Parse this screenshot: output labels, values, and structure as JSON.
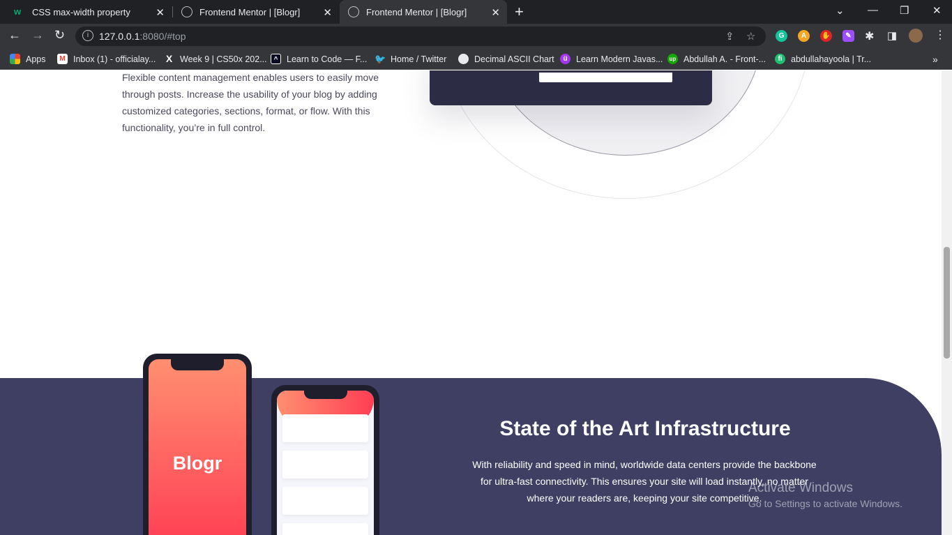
{
  "tabs": [
    {
      "title": "CSS max-width property",
      "favicon": "w3schools-icon",
      "color": "#04aa6d"
    },
    {
      "title": "Frontend Mentor | [Blogr]",
      "favicon": "globe-icon",
      "color": "#bdc1c6"
    },
    {
      "title": "Frontend Mentor | [Blogr]",
      "favicon": "globe-icon",
      "color": "#bdc1c6"
    }
  ],
  "address_bar": {
    "host": "127.0.0.1",
    "rest": ":8080/#top"
  },
  "bookmarks": [
    {
      "label": "Apps",
      "icon": "apps-grid-icon"
    },
    {
      "label": "Inbox (1) - officialay...",
      "icon": "gmail-icon"
    },
    {
      "label": "Week 9 | CS50x 202...",
      "icon": "x-icon"
    },
    {
      "label": "Learn to Code — F...",
      "icon": "freecodecamp-icon"
    },
    {
      "label": "Home / Twitter",
      "icon": "twitter-icon"
    },
    {
      "label": "Decimal ASCII Chart",
      "icon": "globe-icon"
    },
    {
      "label": "Learn Modern Javas...",
      "icon": "udemy-icon"
    },
    {
      "label": "Abdullah A. - Front-...",
      "icon": "upwork-icon"
    },
    {
      "label": "abdullahayoola | Tr...",
      "icon": "fiverr-icon"
    }
  ],
  "feature": {
    "text": "Flexible content management enables users to easily move through posts. Increase the usability of your blog by adding customized categories, sections, format, or flow. With this functionality, you’re in full control."
  },
  "infrastructure": {
    "title": "State of the Art Infrastructure",
    "body": "With reliability and speed in mind, worldwide data centers provide the backbone for ultra-fast connectivity. This ensures your site will load instantly, no matter where your readers are, keeping your site competitive."
  },
  "phone": {
    "logo": "Blogr"
  },
  "watermark": {
    "line1": "Activate Windows",
    "line2": "Go to Settings to activate Windows."
  },
  "colors": {
    "infra_bg": "#3f3f63",
    "gradient_start": "#ff8f70",
    "gradient_end": "#ff3d54",
    "text_dark": "#49495e"
  }
}
